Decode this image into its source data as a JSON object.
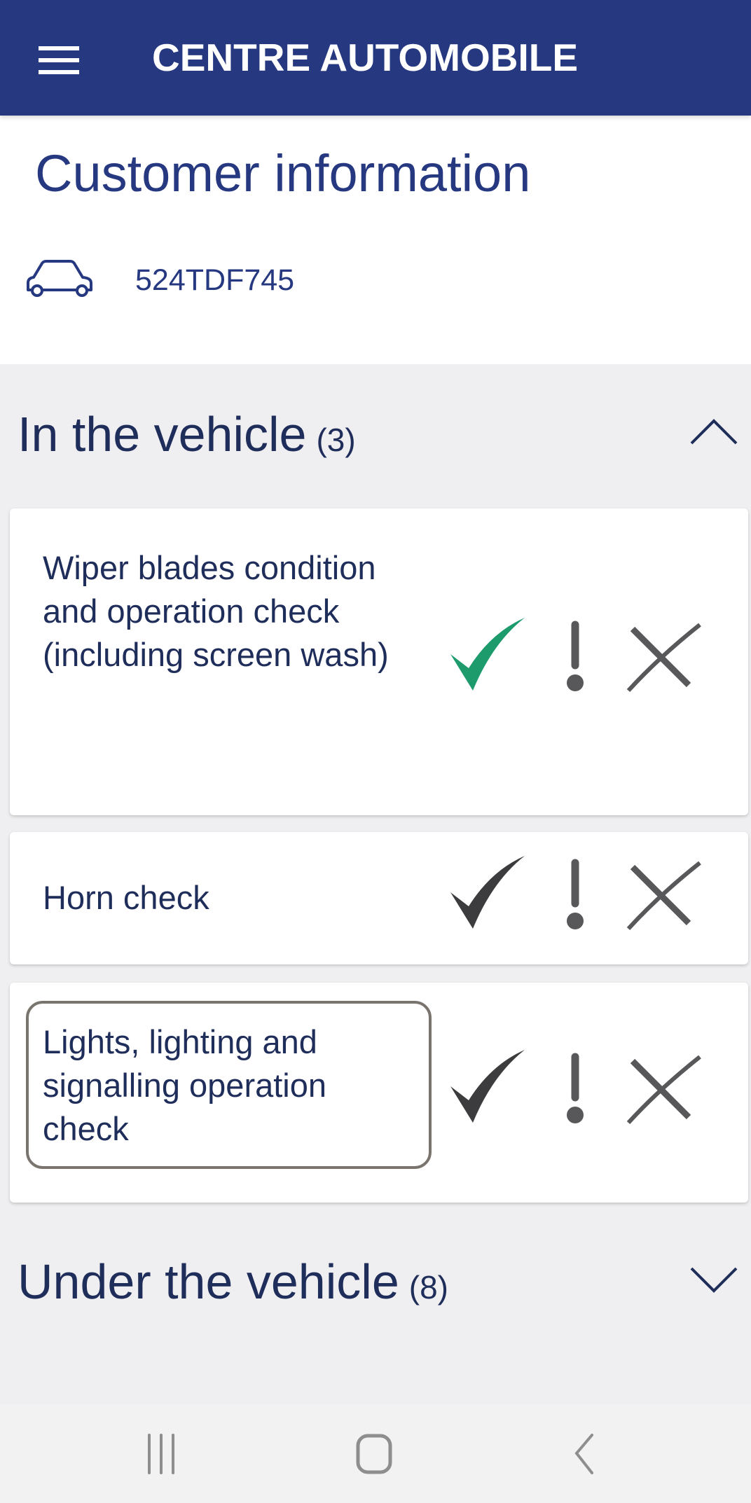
{
  "appbar": {
    "title": "CENTRE AUTOMOBILE",
    "menu_icon": "hamburger-menu-icon"
  },
  "customer": {
    "title": "Customer information",
    "vehicle_icon": "car-icon",
    "plate": "524TDF745"
  },
  "sections": [
    {
      "title": "In the vehicle",
      "count": "(3)",
      "expanded": true,
      "items": [
        {
          "label": "Wiper blades condition and operation check (including screen wash)",
          "selected": "ok"
        },
        {
          "label": "Horn check",
          "selected": null
        },
        {
          "label": "Lights, lighting and signalling operation check",
          "selected": null,
          "focused": true
        }
      ]
    },
    {
      "title": "Under the vehicle",
      "count": "(8)",
      "expanded": false
    }
  ],
  "colors": {
    "brand": "#263880",
    "ok": "#1d9b6c",
    "neutral_icon": "#58585a"
  },
  "options": [
    "check-icon",
    "exclamation-icon",
    "cross-icon"
  ],
  "navbar": [
    "recent-apps-icon",
    "home-icon",
    "back-icon"
  ]
}
